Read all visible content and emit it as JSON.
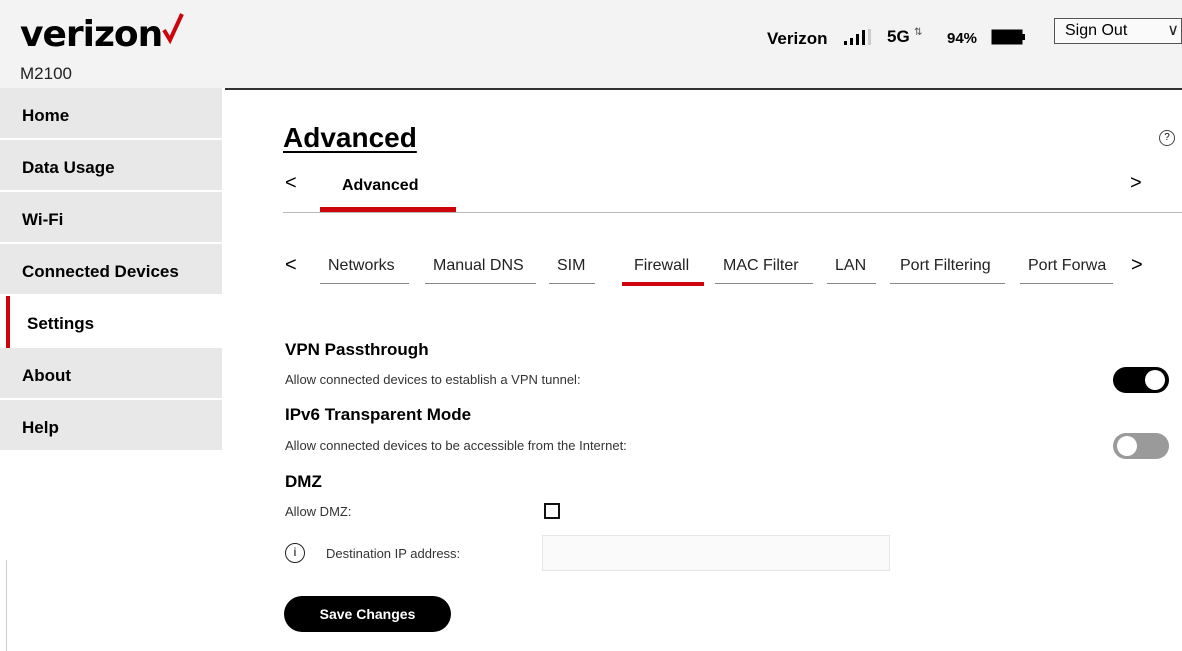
{
  "header": {
    "logo": "verizon",
    "model": "M2100",
    "carrier": "Verizon",
    "network": "5G",
    "battery_percent": "94%",
    "signal_bars": 4,
    "sign_out_label": "Sign Out"
  },
  "sidebar": {
    "items": [
      {
        "label": "Home"
      },
      {
        "label": "Data Usage"
      },
      {
        "label": "Wi-Fi"
      },
      {
        "label": "Connected Devices"
      },
      {
        "label": "Settings",
        "active": true
      },
      {
        "label": "About"
      },
      {
        "label": "Help"
      }
    ]
  },
  "main": {
    "title": "Advanced",
    "tabs": [
      {
        "label": "Advanced",
        "active": true
      }
    ],
    "prev_glyph": "<",
    "next_glyph": ">",
    "subtabs": [
      {
        "label": "Networks"
      },
      {
        "label": "Manual DNS"
      },
      {
        "label": "SIM"
      },
      {
        "label": "Firewall",
        "active": true
      },
      {
        "label": "MAC Filter"
      },
      {
        "label": "LAN"
      },
      {
        "label": "Port Filtering"
      },
      {
        "label": "Port Forwa"
      }
    ],
    "vpn": {
      "title": "VPN Passthrough",
      "desc": "Allow connected devices to establish a VPN tunnel:",
      "enabled": true
    },
    "ipv6": {
      "title": "IPv6 Transparent Mode",
      "desc": "Allow connected devices to be accessible from the Internet:",
      "enabled": false
    },
    "dmz": {
      "title": "DMZ",
      "allow_label": "Allow DMZ:",
      "allow_checked": false,
      "dest_label": "Destination IP address:",
      "dest_value": ""
    },
    "save_label": "Save Changes"
  },
  "colors": {
    "accent": "#cd040b",
    "toggle_on": "#000000",
    "toggle_off": "#9a9a9a",
    "nav_bg": "#e8e8e8",
    "header_bg": "#f3f3f3"
  }
}
